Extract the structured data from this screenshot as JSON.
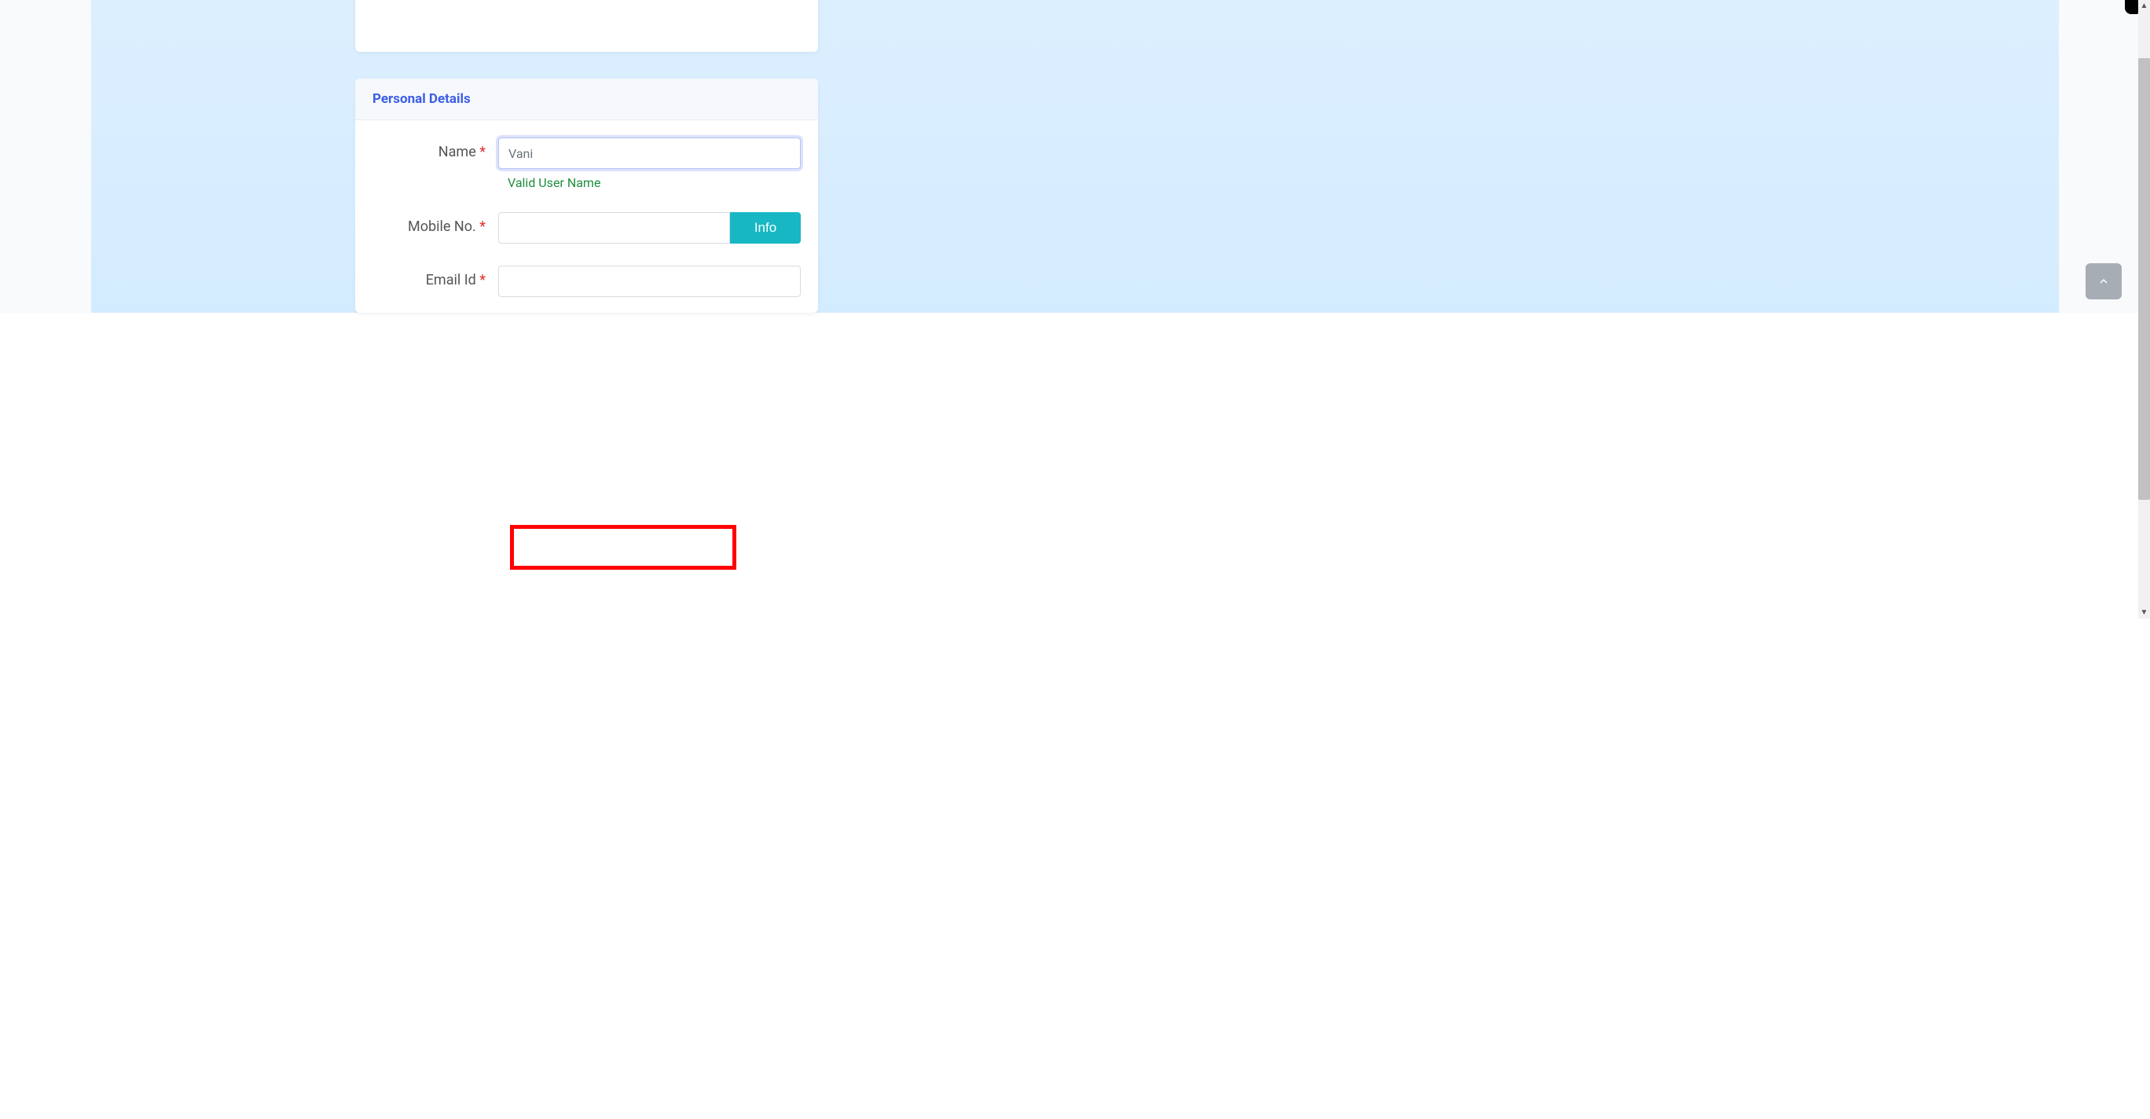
{
  "personal_details": {
    "title": "Personal Details",
    "name": {
      "label": "Name",
      "value": "Vani",
      "valid_msg": "Valid User Name"
    },
    "mobile": {
      "label": "Mobile No.",
      "value": "",
      "info_button": "Info"
    },
    "email": {
      "label": "Email Id",
      "value": ""
    }
  },
  "required_marker": "*"
}
